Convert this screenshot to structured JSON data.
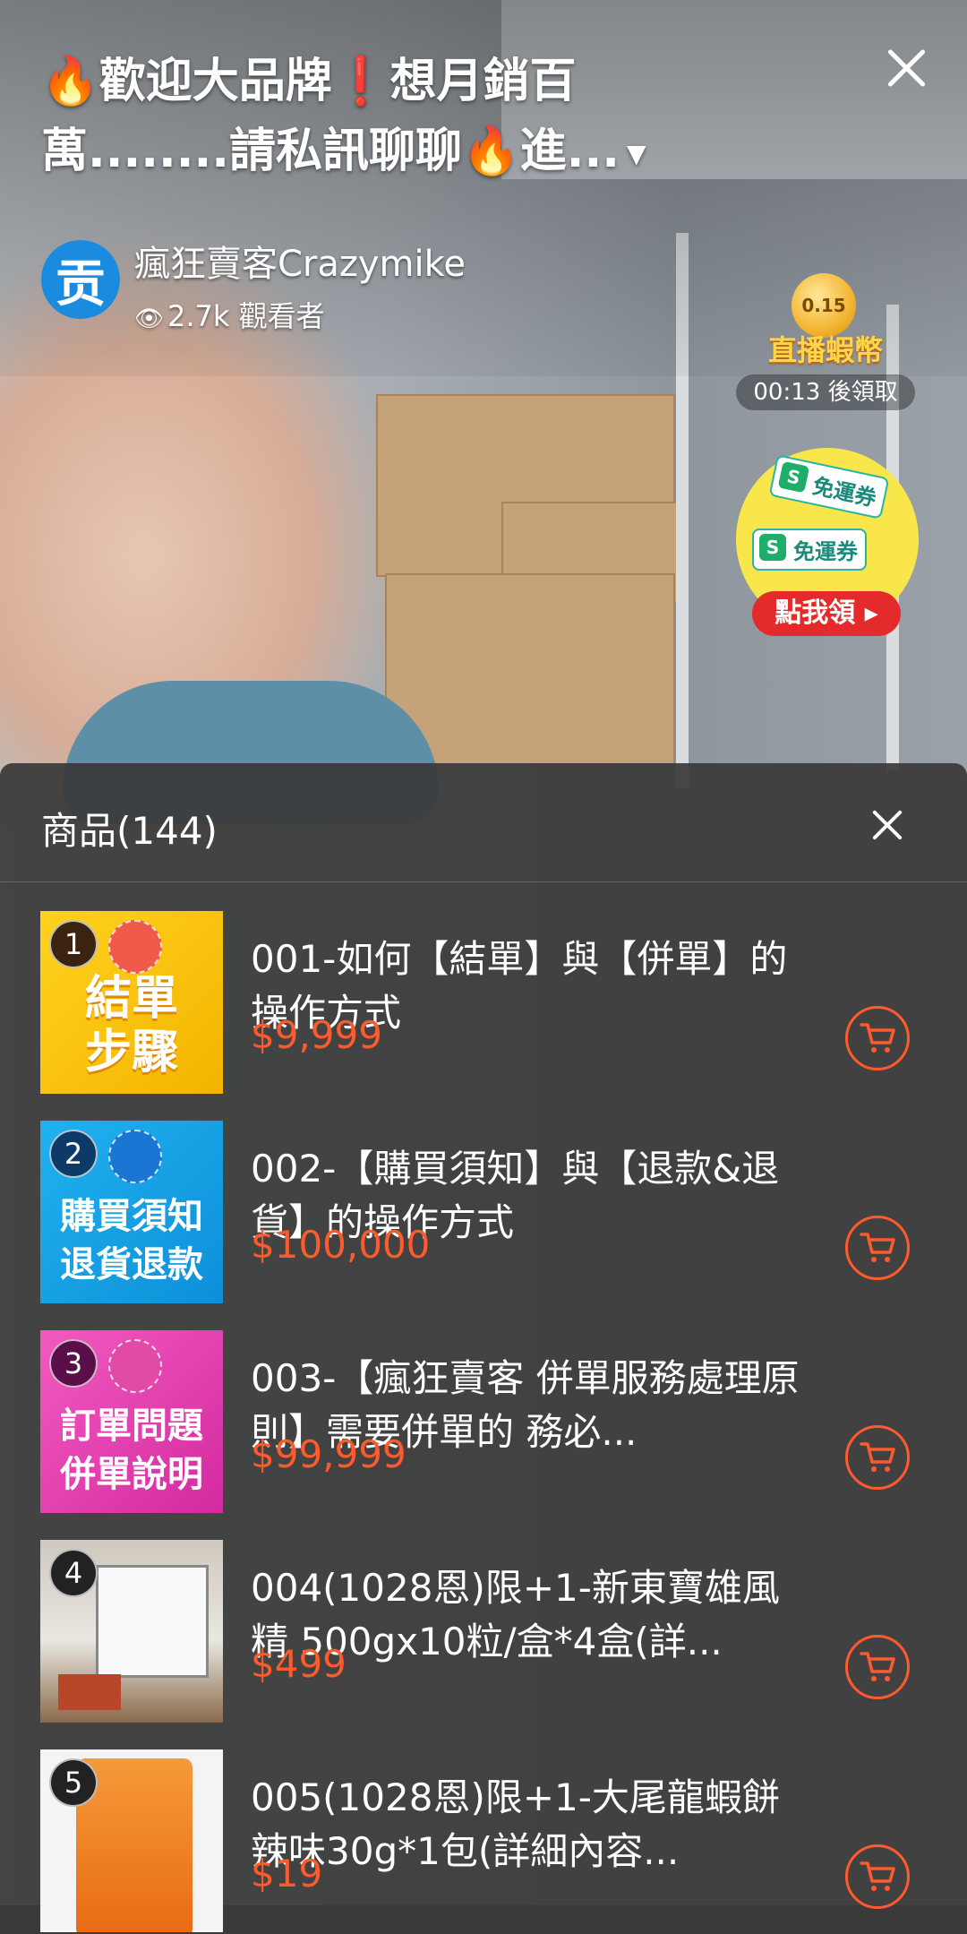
{
  "stream": {
    "title": "🔥歡迎大品牌❗想月銷百萬........請私訊聊聊🔥進...",
    "title_dropdown": "▼",
    "host_avatar_char": "贡",
    "host_name": "瘋狂賣客Crazymike",
    "viewers": "2.7k 觀看者",
    "coin": {
      "value": "0.15",
      "label": "直播蝦幣",
      "timer": "00:13 後領取"
    },
    "voucher": {
      "ticket_label": "免運券",
      "button": "點我領 ▸"
    }
  },
  "panel": {
    "title": "商品(144)",
    "items": [
      {
        "index": "1",
        "thumb_lines": [
          "結單",
          "步驟"
        ],
        "name": "001-如何【結單】與【併單】的操作方式",
        "price": "$9,999"
      },
      {
        "index": "2",
        "thumb_lines": [
          "購買須知",
          "退貨退款"
        ],
        "name": "002-【購買須知】與【退款&退貨】的操作方式",
        "price": "$100,000"
      },
      {
        "index": "3",
        "thumb_lines": [
          "訂單問題",
          "併單說明"
        ],
        "name": "003-【瘋狂賣客 併單服務處理原則】需要併單的 務必...",
        "price": "$99,999"
      },
      {
        "index": "4",
        "thumb_lines": [],
        "name": "004(1028恩)限+1-新東寶雄風精 500gx10粒/盒*4盒(詳...",
        "price": "$499"
      },
      {
        "index": "5",
        "thumb_lines": [],
        "name": "005(1028恩)限+1-大尾龍蝦餅 辣味30g*1包(詳細內容...",
        "price": "$19"
      }
    ]
  }
}
